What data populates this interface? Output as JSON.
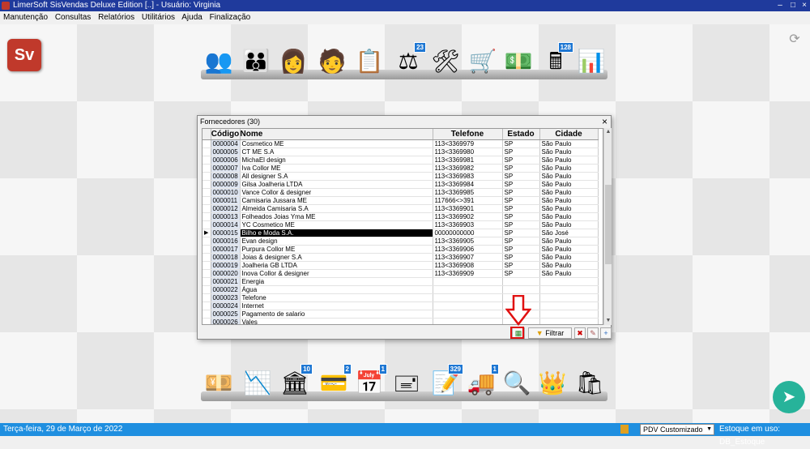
{
  "window": {
    "title": "LimerSoft SisVendas Deluxe Edition [..] - Usuário: Virginia"
  },
  "menu": [
    "Manutenção",
    "Consultas",
    "Relatórios",
    "Utilitários",
    "Ajuda",
    "Finalização"
  ],
  "top_toolbar": [
    {
      "icon": "users-group-icon"
    },
    {
      "icon": "clients-icon"
    },
    {
      "icon": "women-users-icon"
    },
    {
      "icon": "employee-icon"
    },
    {
      "icon": "list-icon"
    },
    {
      "icon": "scale-icon",
      "badge": "23"
    },
    {
      "icon": "tools-icon"
    },
    {
      "icon": "shopping-cart-icon"
    },
    {
      "icon": "money-search-icon"
    },
    {
      "icon": "cash-register-icon",
      "badge": "128"
    },
    {
      "icon": "bar-chart-icon"
    }
  ],
  "bottom_toolbar": [
    {
      "icon": "money-stack-icon"
    },
    {
      "icon": "chart-down-icon"
    },
    {
      "icon": "bank-icon",
      "badge": "10"
    },
    {
      "icon": "card-machine-icon",
      "badge": "2"
    },
    {
      "icon": "calendar-check-icon",
      "badge": "1"
    },
    {
      "icon": "stamp-icon"
    },
    {
      "icon": "clipboard-pen-icon",
      "badge": "329"
    },
    {
      "icon": "truck-icon",
      "badge": "1"
    },
    {
      "icon": "magnifier-icon"
    },
    {
      "icon": "crown-icon"
    },
    {
      "icon": "shopping-bag-icon"
    }
  ],
  "dialog": {
    "title": "Fornecedores (30)",
    "close": "×",
    "columns": [
      "Código",
      "Nome",
      "Telefone",
      "Estado",
      "Cidade"
    ],
    "rows": [
      [
        "0000004",
        "Cosmetico ME",
        "113<3369979",
        "SP",
        "São Paulo"
      ],
      [
        "0000005",
        "CT ME S.A",
        "113<3369980",
        "SP",
        "São Paulo"
      ],
      [
        "0000006",
        "MichaEl design",
        "113<3369981",
        "SP",
        "São Paulo"
      ],
      [
        "0000007",
        "Iva Collor ME",
        "113<3369982",
        "SP",
        "São Paulo"
      ],
      [
        "0000008",
        "All designer S.A",
        "113<3369983",
        "SP",
        "São Paulo"
      ],
      [
        "0000009",
        "Gilsa Joalheria LTDA",
        "113<3369984",
        "SP",
        "São Paulo"
      ],
      [
        "0000010",
        "Vance Collor & designer",
        "113<3369985",
        "SP",
        "São Paulo"
      ],
      [
        "0000011",
        "Camisaria Jussara ME",
        "117666<>391",
        "SP",
        "São Paulo"
      ],
      [
        "0000012",
        "Almeida Camisaria S.A",
        "113<3369901",
        "SP",
        "São Paulo"
      ],
      [
        "0000013",
        "Folheados Joias Yma ME",
        "113<3369902",
        "SP",
        "São Paulo"
      ],
      [
        "0000014",
        "YC Cosmetico ME",
        "113<3369903",
        "SP",
        "São Paulo"
      ],
      [
        "0000015",
        "Bilho e Moda S.A.",
        "00000000000",
        "SP",
        "São José"
      ],
      [
        "0000016",
        "Evan design",
        "113<3369905",
        "SP",
        "São Paulo"
      ],
      [
        "0000017",
        "Purpura Collor ME",
        "113<3369906",
        "SP",
        "São Paulo"
      ],
      [
        "0000018",
        "Joias & designer S.A",
        "113<3369907",
        "SP",
        "São Paulo"
      ],
      [
        "0000019",
        "Joalheria GB LTDA",
        "113<3369908",
        "SP",
        "São Paulo"
      ],
      [
        "0000020",
        "Inova Collor & designer",
        "113<3369909",
        "SP",
        "São Paulo"
      ],
      [
        "0000021",
        "Energia",
        "",
        "",
        ""
      ],
      [
        "0000022",
        "Água",
        "",
        "",
        ""
      ],
      [
        "0000023",
        "Telefone",
        "",
        "",
        ""
      ],
      [
        "0000024",
        "Internet",
        "",
        "",
        ""
      ],
      [
        "0000025",
        "Pagamento de salario",
        "",
        "",
        ""
      ],
      [
        "0000026",
        "Vales",
        "",
        "",
        ""
      ]
    ],
    "selected_row": 11,
    "current_marker": "▶",
    "filter_label": "Filtrar"
  },
  "status": {
    "date": "Terça-feira, 29 de Março de 2022",
    "pdv": "PDV Customizado",
    "stock": "Estoque em uso: DB_Estoque"
  },
  "colors": {
    "titlebar": "#1f3a9c",
    "statusbar": "#1f8fe0",
    "accent_red": "#e01010",
    "badge": "#1e77d3"
  }
}
